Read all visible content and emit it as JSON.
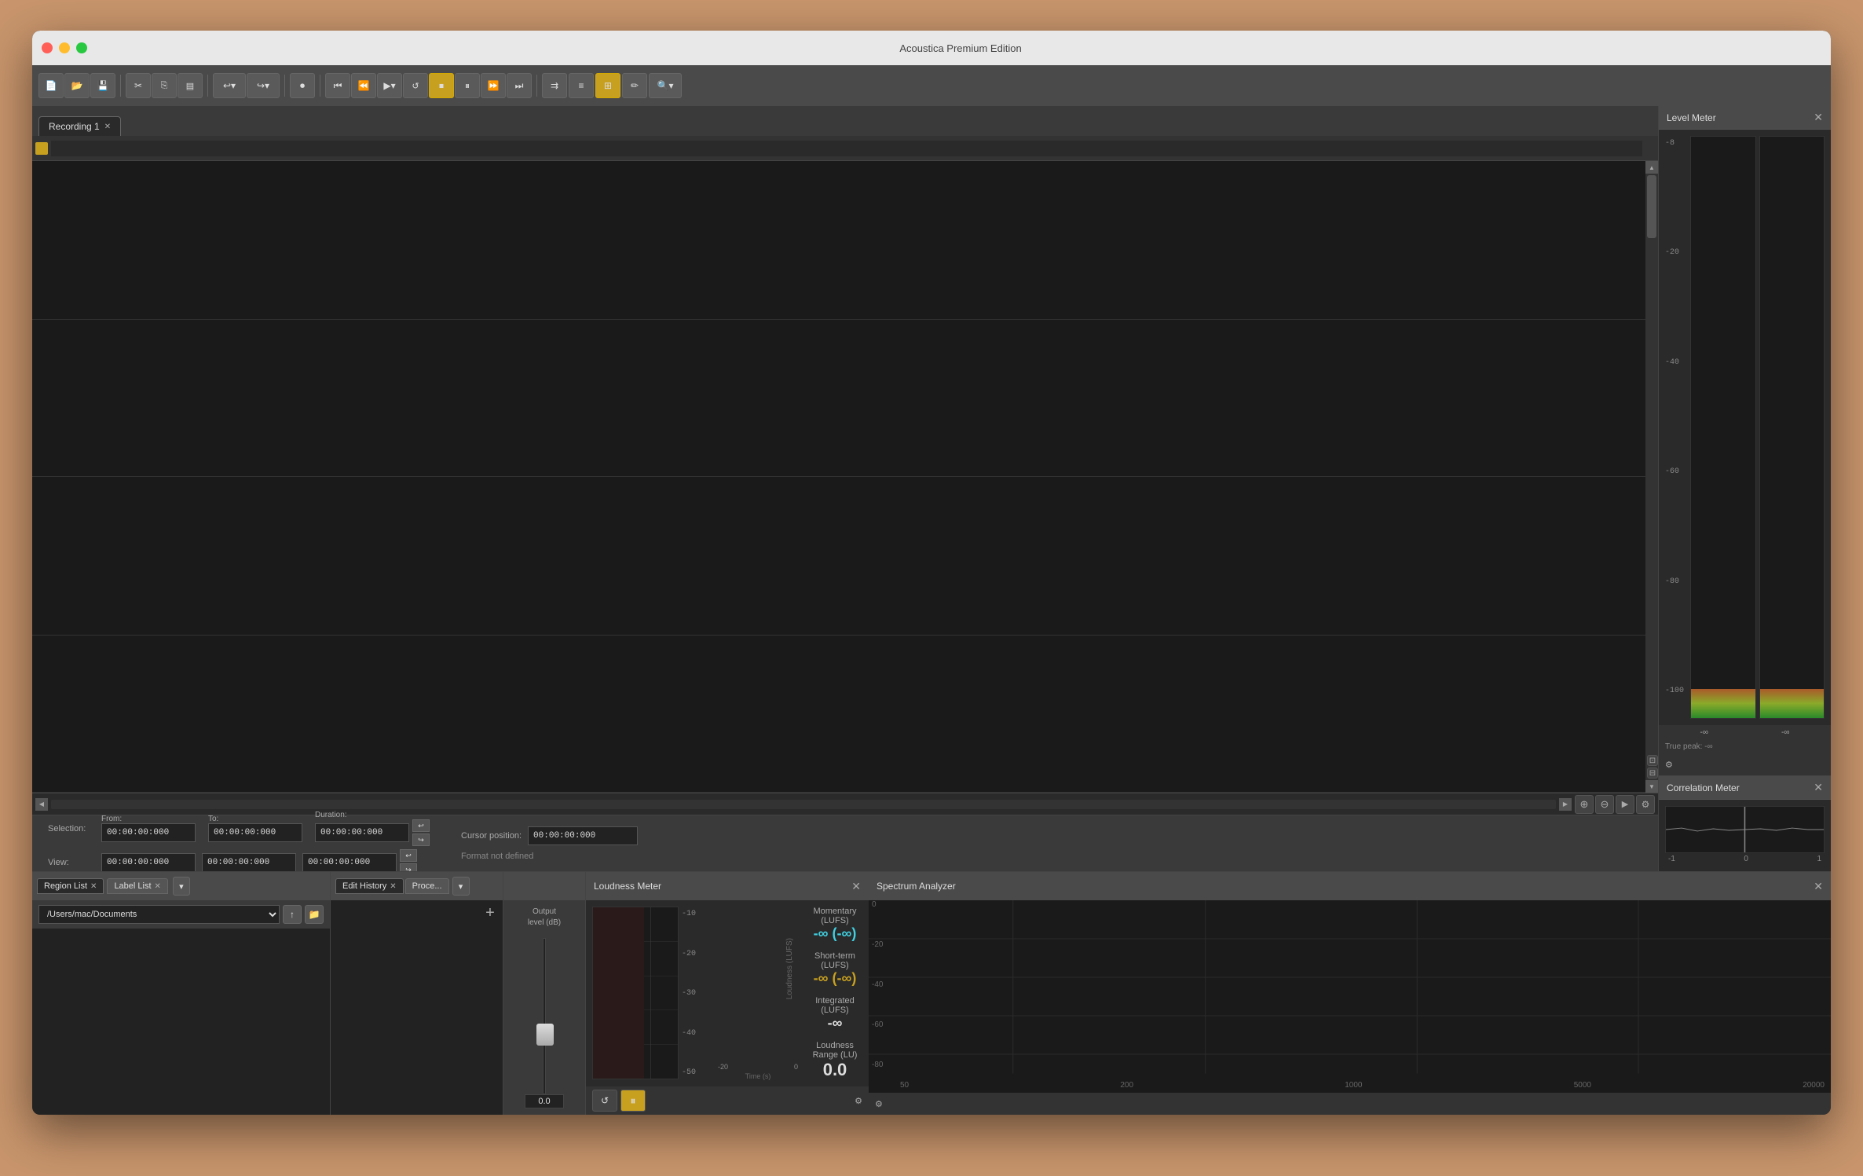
{
  "window": {
    "title": "Acoustica Premium Edition"
  },
  "traffic_lights": {
    "close": "close",
    "minimize": "minimize",
    "maximize": "maximize"
  },
  "toolbar": {
    "buttons": [
      {
        "id": "new",
        "label": "📄",
        "icon": "new-file-icon",
        "active": false
      },
      {
        "id": "open",
        "label": "📂",
        "icon": "open-file-icon",
        "active": false
      },
      {
        "id": "save",
        "label": "💾",
        "icon": "save-file-icon",
        "active": false
      },
      {
        "id": "cut",
        "label": "✂",
        "icon": "cut-icon",
        "active": false
      },
      {
        "id": "copy",
        "label": "⎘",
        "icon": "copy-icon",
        "active": false
      },
      {
        "id": "paste",
        "label": "📋",
        "icon": "paste-icon",
        "active": false
      },
      {
        "id": "undo",
        "label": "↩",
        "icon": "undo-icon",
        "active": false
      },
      {
        "id": "redo",
        "label": "↪",
        "icon": "redo-icon",
        "active": false
      },
      {
        "id": "record",
        "label": "⏺",
        "icon": "record-icon",
        "active": false
      },
      {
        "id": "goto-start",
        "label": "⏮",
        "icon": "goto-start-icon",
        "active": false
      },
      {
        "id": "rewind",
        "label": "⏪",
        "icon": "rewind-icon",
        "active": false
      },
      {
        "id": "play",
        "label": "▶",
        "icon": "play-icon",
        "active": false
      },
      {
        "id": "loop",
        "label": "🔁",
        "icon": "loop-icon",
        "active": false
      },
      {
        "id": "stop",
        "label": "⏹",
        "icon": "stop-icon",
        "active": true
      },
      {
        "id": "pause",
        "label": "⏸",
        "icon": "pause-icon",
        "active": false
      },
      {
        "id": "fast-forward",
        "label": "⏩",
        "icon": "fast-forward-icon",
        "active": false
      },
      {
        "id": "goto-end",
        "label": "⏭",
        "icon": "goto-end-icon",
        "active": false
      },
      {
        "id": "loop2",
        "label": "⇉",
        "icon": "loop2-icon",
        "active": false
      },
      {
        "id": "stack",
        "label": "≡",
        "icon": "stack-icon",
        "active": false
      },
      {
        "id": "screen",
        "label": "⊞",
        "icon": "screen-icon",
        "active": true
      },
      {
        "id": "pencil",
        "label": "✏",
        "icon": "pencil-icon",
        "active": false
      },
      {
        "id": "search",
        "label": "🔍",
        "icon": "search-icon",
        "active": false
      }
    ]
  },
  "tabs": [
    {
      "id": "recording1",
      "label": "Recording 1",
      "active": true,
      "closeable": true
    }
  ],
  "selection": {
    "from_label": "From:",
    "to_label": "To:",
    "duration_label": "Duration:",
    "selection_label": "Selection:",
    "view_label": "View:",
    "cursor_position_label": "Cursor position:",
    "format_label": "Format not defined",
    "from_value": "00:00:00:000",
    "to_value": "00:00:00:000",
    "duration_value": "00:00:00:000",
    "view_from_value": "00:00:00:000",
    "view_to_value": "00:00:00:000",
    "view_duration_value": "00:00:00:000",
    "cursor_value": "00:00:00:000"
  },
  "right_panels": {
    "level_meter": {
      "title": "Level Meter",
      "scale": [
        "-8",
        "-20",
        "-40",
        "-60",
        "-80",
        "-100"
      ],
      "left_peak": "-∞",
      "right_peak": "-∞",
      "true_peak_label": "True peak:",
      "true_peak_value": "-∞"
    },
    "correlation_meter": {
      "title": "Correlation Meter",
      "scale_left": "-1",
      "scale_center": "0",
      "scale_right": "1"
    }
  },
  "bottom_panels": {
    "region_list": {
      "title": "Region List",
      "closeable": true,
      "path": "/Users/mac/Documents"
    },
    "label_list": {
      "title": "Label List",
      "closeable": true
    },
    "edit_history": {
      "title": "Edit History",
      "closeable": true
    },
    "process": {
      "title": "Proce...",
      "closeable": false,
      "output_level_label": "Output\nlevel (dB)",
      "fader_value": "0.0"
    },
    "loudness_meter": {
      "title": "Loudness Meter",
      "closeable": true,
      "momentary_label": "Momentary (LUFS)",
      "momentary_value": "-∞ (-∞)",
      "short_term_label": "Short-term (LUFS)",
      "short_term_value": "-∞ (-∞)",
      "integrated_label": "Integrated (LUFS)",
      "integrated_value": "-∞",
      "loudness_range_label": "Loudness Range (LU)",
      "loudness_range_value": "0.0",
      "scale_v": [
        "-10",
        "-20",
        "-30",
        "-40",
        "-50"
      ],
      "scale_h": [
        "-20",
        "0"
      ],
      "y_axis_label": "Loudness (LUFS)",
      "x_axis_label": "Time (s)"
    },
    "spectrum_analyzer": {
      "title": "Spectrum Analyzer",
      "closeable": true,
      "scale_v": [
        "0",
        "-20",
        "-40",
        "-60",
        "-80"
      ],
      "scale_h": [
        "50",
        "200",
        "1000",
        "5000",
        "20000"
      ]
    }
  }
}
